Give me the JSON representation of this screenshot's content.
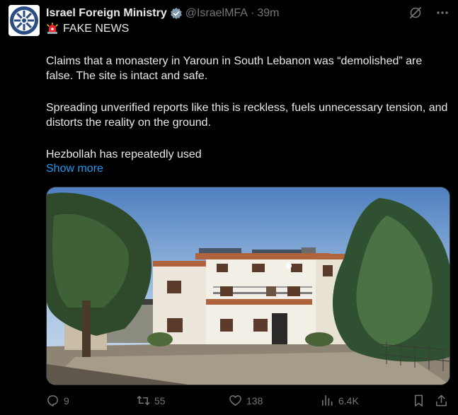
{
  "post": {
    "author_name": "Israel Foreign Ministry",
    "handle": "@IsraelMFA",
    "separator": "·",
    "time": "39m",
    "label": "FAKE NEWS",
    "paragraphs": [
      "Claims that a monastery in Yaroun in South Lebanon was “demolished” are false. The site is intact and safe.",
      "Spreading unverified reports like this is reckless, fuels unnecessary tension, and distorts the reality on the ground.",
      "Hezbollah has repeatedly used"
    ],
    "show_more": "Show more"
  },
  "actions": {
    "replies": "9",
    "reposts": "55",
    "likes": "138",
    "views": "6.4K"
  },
  "colors": {
    "background": "#000000",
    "text": "#e7e9ea",
    "muted": "#71767b",
    "link": "#1d9bf0",
    "verified_badge": "#829aab",
    "siren": "#f4212e"
  },
  "icons": [
    "verified-badge-icon",
    "grok-icon",
    "more-icon",
    "siren-icon",
    "reply-icon",
    "repost-icon",
    "like-icon",
    "views-icon",
    "bookmark-icon",
    "share-icon"
  ]
}
